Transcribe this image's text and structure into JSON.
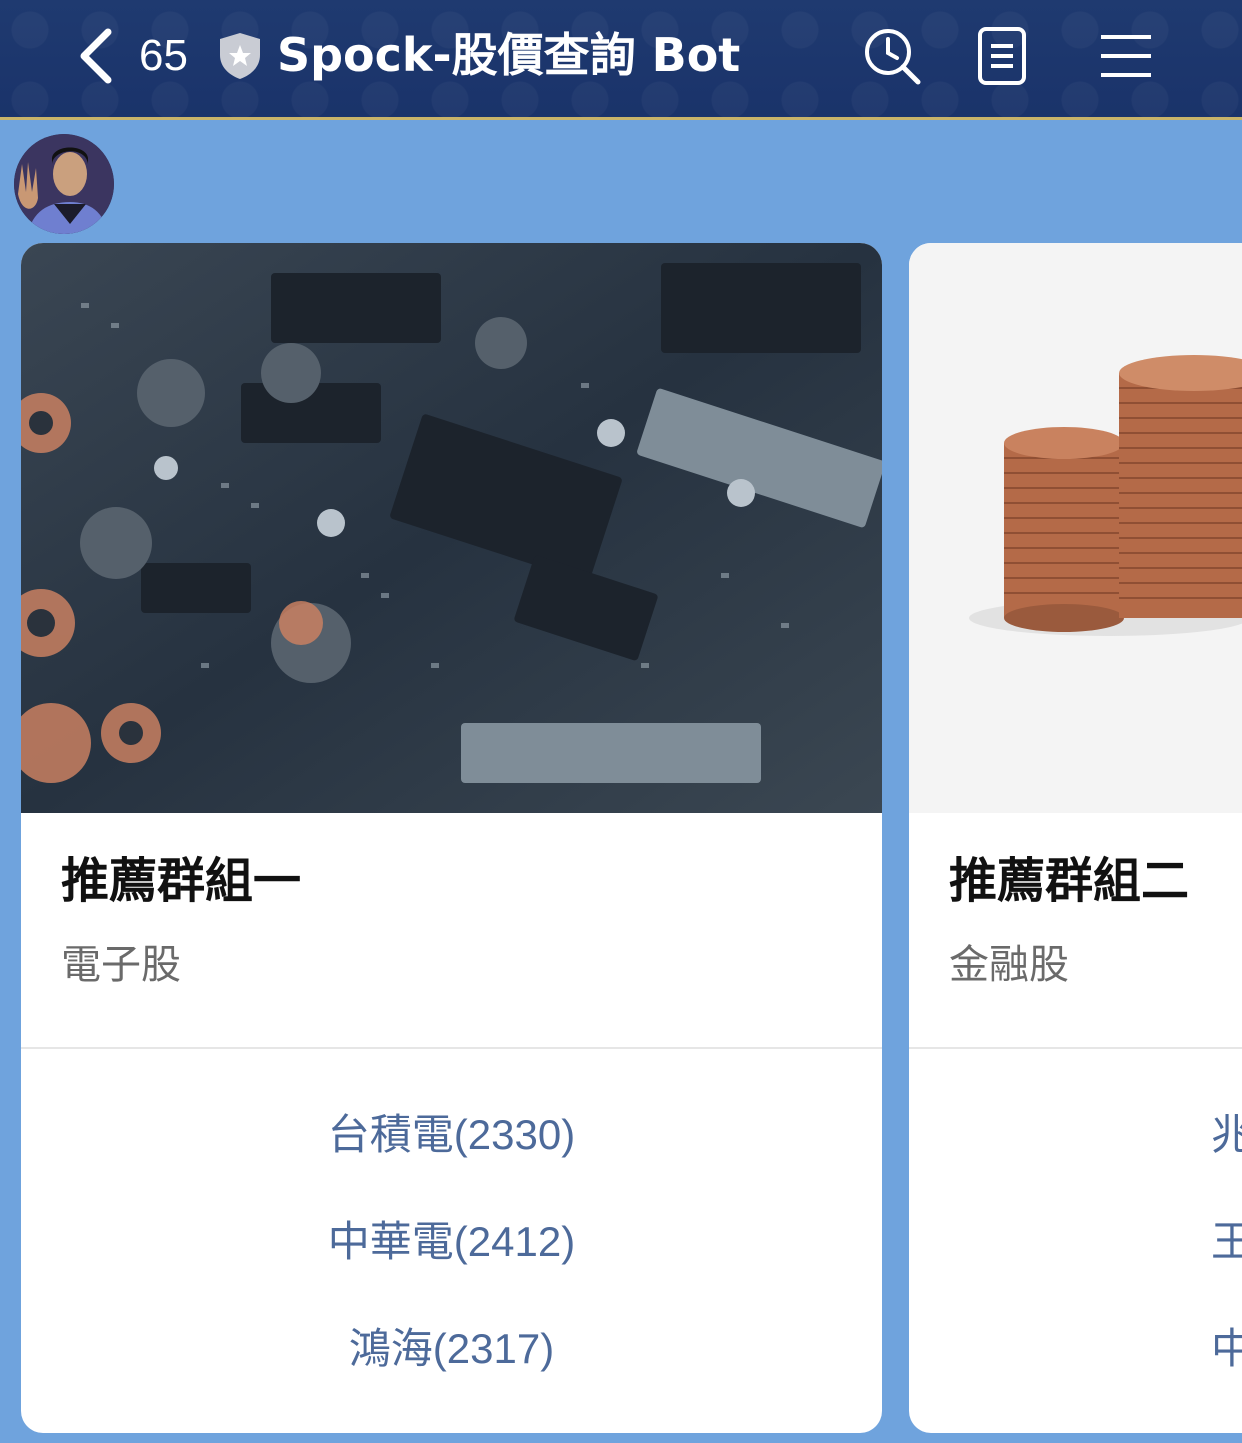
{
  "header": {
    "unread_count": "65",
    "title": "Spock-股價查詢 Bot",
    "icons": [
      "back-chevron-icon",
      "verified-shield-icon",
      "clock-search-icon",
      "notes-icon",
      "menu-icon"
    ]
  },
  "colors": {
    "header_bg": "#1d386d",
    "header_border": "#c9b46a",
    "chat_bg": "#6fa3dd",
    "action_text": "#4d6a9a"
  },
  "cards": [
    {
      "title": "推薦群組一",
      "subtitle": "電子股",
      "image": "circuit-board-image",
      "actions": [
        "台積電(2330)",
        "中華電(2412)",
        "鴻海(2317)"
      ]
    },
    {
      "title": "推薦群組二",
      "subtitle": "金融股",
      "image": "coin-stacks-image",
      "actions": [
        "兆",
        "王",
        "中"
      ]
    }
  ]
}
